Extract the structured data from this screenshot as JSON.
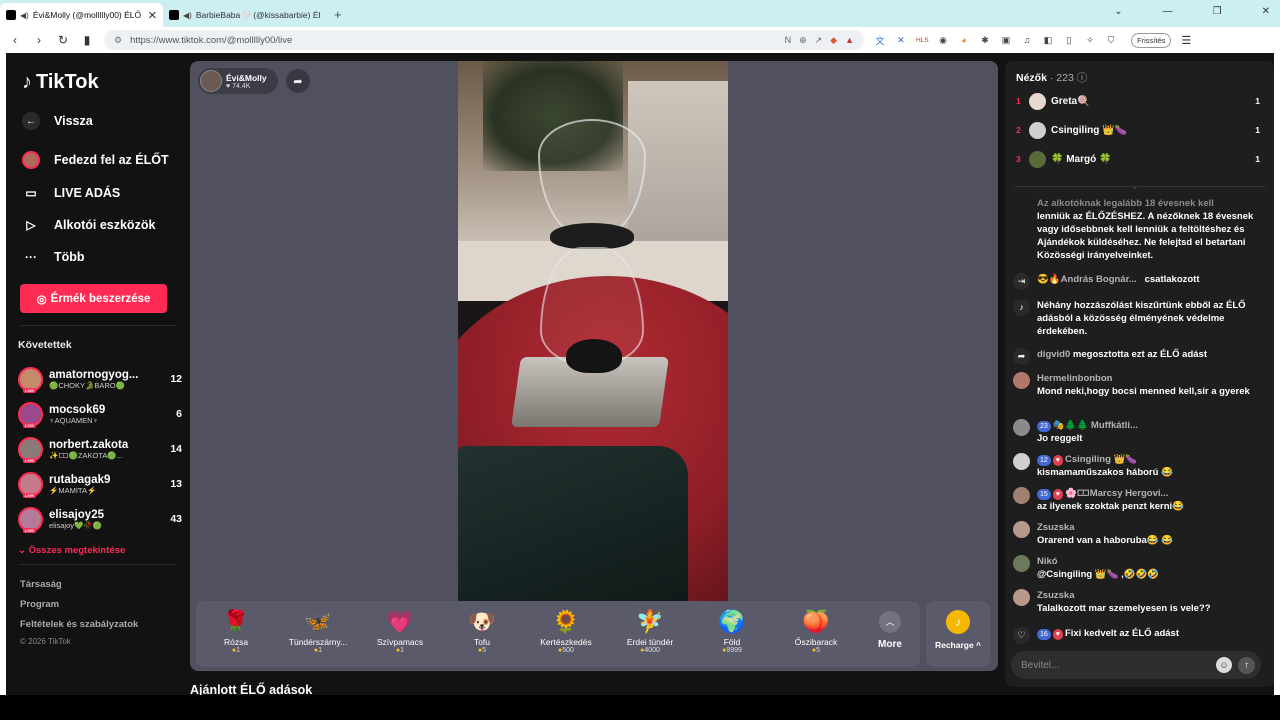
{
  "browser": {
    "tabs": [
      {
        "title": "Évi&Molly (@mollllly00) ÉLŐ",
        "active": true
      },
      {
        "title": "BarbieBaba🤍 (@kissabarbie) ÉL",
        "active": false
      }
    ],
    "new_tab": "+",
    "url": "https://www.tiktok.com/@mollllly00/live",
    "update_label": "Frissítés"
  },
  "nav": {
    "logo": "TikTok",
    "back": "Vissza",
    "explore": "Fedezd fel az ÉLŐT",
    "go_live": "LIVE ADÁS",
    "creator_tools": "Alkotói eszközök",
    "more": "Több",
    "coins_button": "Érmék beszerzése",
    "following_title": "Követettek",
    "following": [
      {
        "name": "amatornogyog...",
        "sub": "🟢CHOKY🐊BARO🟢",
        "count": "12"
      },
      {
        "name": "mocsok69",
        "sub": "♆AQUAMEN♆",
        "count": "6"
      },
      {
        "name": "norbert.zakota",
        "sub": "✨🀱🟢ZAKOTA🟢...",
        "count": "14"
      },
      {
        "name": "rutabagak9",
        "sub": "⚡MAMITA⚡",
        "count": "13"
      },
      {
        "name": "elisajoy25",
        "sub": "elisajoy💚🥀🟢",
        "count": "43"
      }
    ],
    "see_all": "Összes megtekintése",
    "footer": [
      "Társaság",
      "Program",
      "Feltételek és szabályzatok"
    ],
    "copyright": "© 2026 TikTok"
  },
  "player": {
    "host_name": "Évi&Molly",
    "host_likes": "74.4K",
    "gifts": [
      {
        "name": "Rózsa",
        "price": "1",
        "icon": "🌹"
      },
      {
        "name": "Tündérszárny...",
        "price": "1",
        "icon": "🦋"
      },
      {
        "name": "Szívpamacs",
        "price": "1",
        "icon": "💗"
      },
      {
        "name": "Tofu",
        "price": "5",
        "icon": "🐶"
      },
      {
        "name": "Kertészkedés",
        "price": "500",
        "icon": "🌻"
      },
      {
        "name": "Erdei tündér",
        "price": "4000",
        "icon": "🧚"
      },
      {
        "name": "Föld",
        "price": "9999",
        "icon": "🌍"
      },
      {
        "name": "Őszibarack",
        "price": "5",
        "icon": "🍑"
      }
    ],
    "more_label": "More",
    "recharge_label": "Recharge ^",
    "recommended_title": "Ajánlott ÉLŐ adások"
  },
  "viewers": {
    "title": "Nézők",
    "count": "223",
    "top": [
      {
        "rank": "1",
        "name": "Greta🍭",
        "count": "1"
      },
      {
        "rank": "2",
        "name": "Csingiling 👑🍆",
        "count": "1"
      },
      {
        "rank": "3",
        "name": "🍀 Margó 🍀",
        "count": "1"
      }
    ]
  },
  "chat": {
    "notice_dim": "Az alkotóknak legalább 18 évesnek kell",
    "notice": "lenniük az ÉLŐZÉSHEZ. A nézőknek 18 évesnek vagy idősebbnek kell lenniük a feltöltéshez és Ajándékok küldéséhez. Ne felejtsd el betartani Közösségi irányelveinket.",
    "joined_user": "😎🔥András Bognár...",
    "joined_text": "csatlakozott",
    "filter_text": "Néhány hozzászólást kiszűrtünk ebből az ÉLŐ adásból a közösség élményének védelme érdekében.",
    "share_user": "digvid0",
    "share_text": "megosztotta ezt az ÉLŐ adást",
    "messages": [
      {
        "user": "Hermelinbonbon",
        "text": "Mond neki,hogy bocsi menned kell,sír a gyerek",
        "badge": ""
      },
      {
        "user": "🎭🌲🌲 Muffkátli...",
        "text": "Jo reggelt",
        "badge": "23"
      },
      {
        "user": "Csingiling 👑🍆",
        "text": "kismamaműszakos háború 😂",
        "badge": "12"
      },
      {
        "user": "🌸🀱Marcsy Hergovi...",
        "text": "az ilyenek szoktak penzt kerni😂",
        "badge": "15"
      },
      {
        "user": "Zsuzska",
        "text": "Orarend van a haboruba😂 😂",
        "badge": ""
      },
      {
        "user": "Nikó",
        "text": "@Csingiling 👑🍆 ,🤣🤣🤣",
        "badge": ""
      },
      {
        "user": "Zsuzska",
        "text": "Talalkozott mar szemelyesen is vele??",
        "badge": ""
      }
    ],
    "like_user": "Fixi",
    "like_badge": "16",
    "like_text": "kedvelt az ÉLŐ adást",
    "input_placeholder": "Bevitel..."
  }
}
